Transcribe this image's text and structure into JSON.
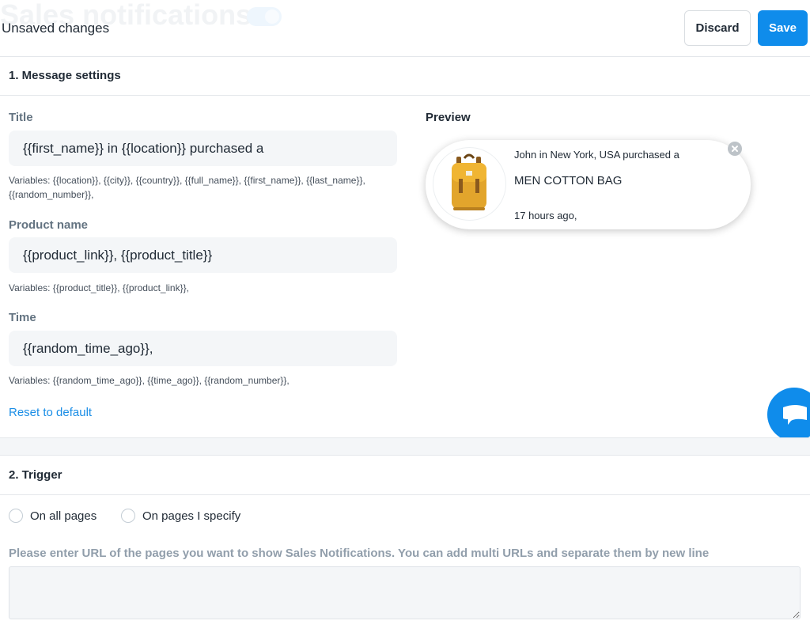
{
  "header": {
    "page_title": "Sales notifications",
    "unsaved_text": "Unsaved changes",
    "discard_label": "Discard",
    "save_label": "Save"
  },
  "message_settings": {
    "section_title": "1. Message settings",
    "title_label": "Title",
    "title_value": "{{first_name}} in {{location}} purchased a",
    "title_hint": "Variables: {{location}}, {{city}}, {{country}}, {{full_name}}, {{first_name}}, {{last_name}}, {{random_number}},",
    "product_label": "Product name",
    "product_value": "{{product_link}}, {{product_title}}",
    "product_hint": "Variables: {{product_title}}, {{product_link}},",
    "time_label": "Time",
    "time_value": "{{random_time_ago}},",
    "time_hint": "Variables: {{random_time_ago}}, {{time_ago}}, {{random_number}},",
    "reset_label": "Reset to default"
  },
  "preview": {
    "label": "Preview",
    "notification_title": "John in New York, USA purchased a",
    "notification_product": "MEN COTTON BAG",
    "notification_time": "17 hours ago,"
  },
  "trigger": {
    "section_title": "2. Trigger",
    "options": [
      "On all pages",
      "On pages I specify"
    ],
    "url_label": "Please enter URL of the pages you want to show Sales Notifications. You can add multi URLs and separate them by new line",
    "url_value": ""
  },
  "icons": {
    "close": "close-icon",
    "chat": "chat-icon",
    "product_image": "backpack-icon"
  },
  "colors": {
    "accent": "#0f8ceb",
    "link": "#1b8ee6",
    "field_bg": "#f4f6f8"
  }
}
